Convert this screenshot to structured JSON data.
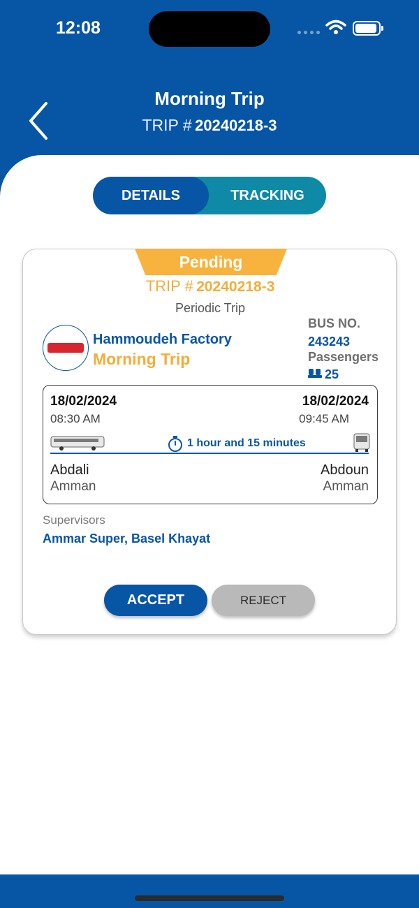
{
  "status_bar": {
    "time": "12:08"
  },
  "header": {
    "title": "Morning Trip",
    "trip_label": "TRIP #",
    "trip_number": "20240218-3",
    "back_icon": "chevron-left-icon"
  },
  "tabs": [
    {
      "label": "DETAILS",
      "selected": true
    },
    {
      "label": "TRACKING",
      "selected": false
    }
  ],
  "card": {
    "status": "Pending",
    "trip_label": "TRIP #",
    "trip_number": "20240218-3",
    "trip_type": "Periodic Trip",
    "company": "Hammoudeh Factory",
    "route_name": "Morning Trip",
    "bus_label": "BUS NO.",
    "bus_number": "243243",
    "passengers_label": "Passengers",
    "passengers_count": "25",
    "schedule": {
      "departure_date": "18/02/2024",
      "departure_time": "08:30 AM",
      "arrival_date": "18/02/2024",
      "arrival_time": "09:45 AM",
      "duration": "1 hour and 15 minutes",
      "from_place": "Abdali",
      "from_city": "Amman",
      "to_place": "Abdoun",
      "to_city": "Amman"
    },
    "supervisors_label": "Supervisors",
    "supervisors": "Ammar Super, Basel Khayat",
    "accept_label": "ACCEPT",
    "reject_label": "REJECT"
  },
  "colors": {
    "primary": "#0756a6",
    "accent": "#f4ad3a",
    "tab_bg": "#0e8aa6",
    "reject_bg": "#b9b9b9"
  }
}
